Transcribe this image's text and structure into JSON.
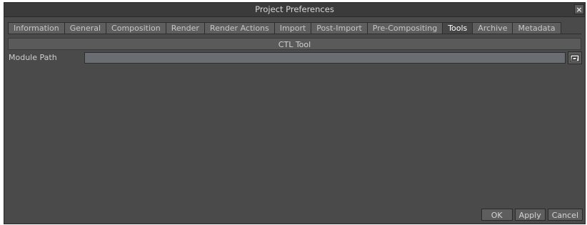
{
  "window": {
    "title": "Project Preferences",
    "close_label": "×"
  },
  "tabs": [
    {
      "label": "Information",
      "active": false
    },
    {
      "label": "General",
      "active": false
    },
    {
      "label": "Composition",
      "active": false
    },
    {
      "label": "Render",
      "active": false
    },
    {
      "label": "Render Actions",
      "active": false
    },
    {
      "label": "Import",
      "active": false
    },
    {
      "label": "Post-Import",
      "active": false
    },
    {
      "label": "Pre-Compositing",
      "active": false
    },
    {
      "label": "Tools",
      "active": true
    },
    {
      "label": "Archive",
      "active": false
    },
    {
      "label": "Metadata",
      "active": false
    }
  ],
  "section": {
    "title": "CTL Tool"
  },
  "fields": {
    "module_path_label": "Module Path",
    "module_path_value": ""
  },
  "icons": {
    "browse": "folder-browse-icon",
    "close": "close-icon"
  },
  "buttons": {
    "ok": "OK",
    "apply": "Apply",
    "cancel": "Cancel"
  }
}
